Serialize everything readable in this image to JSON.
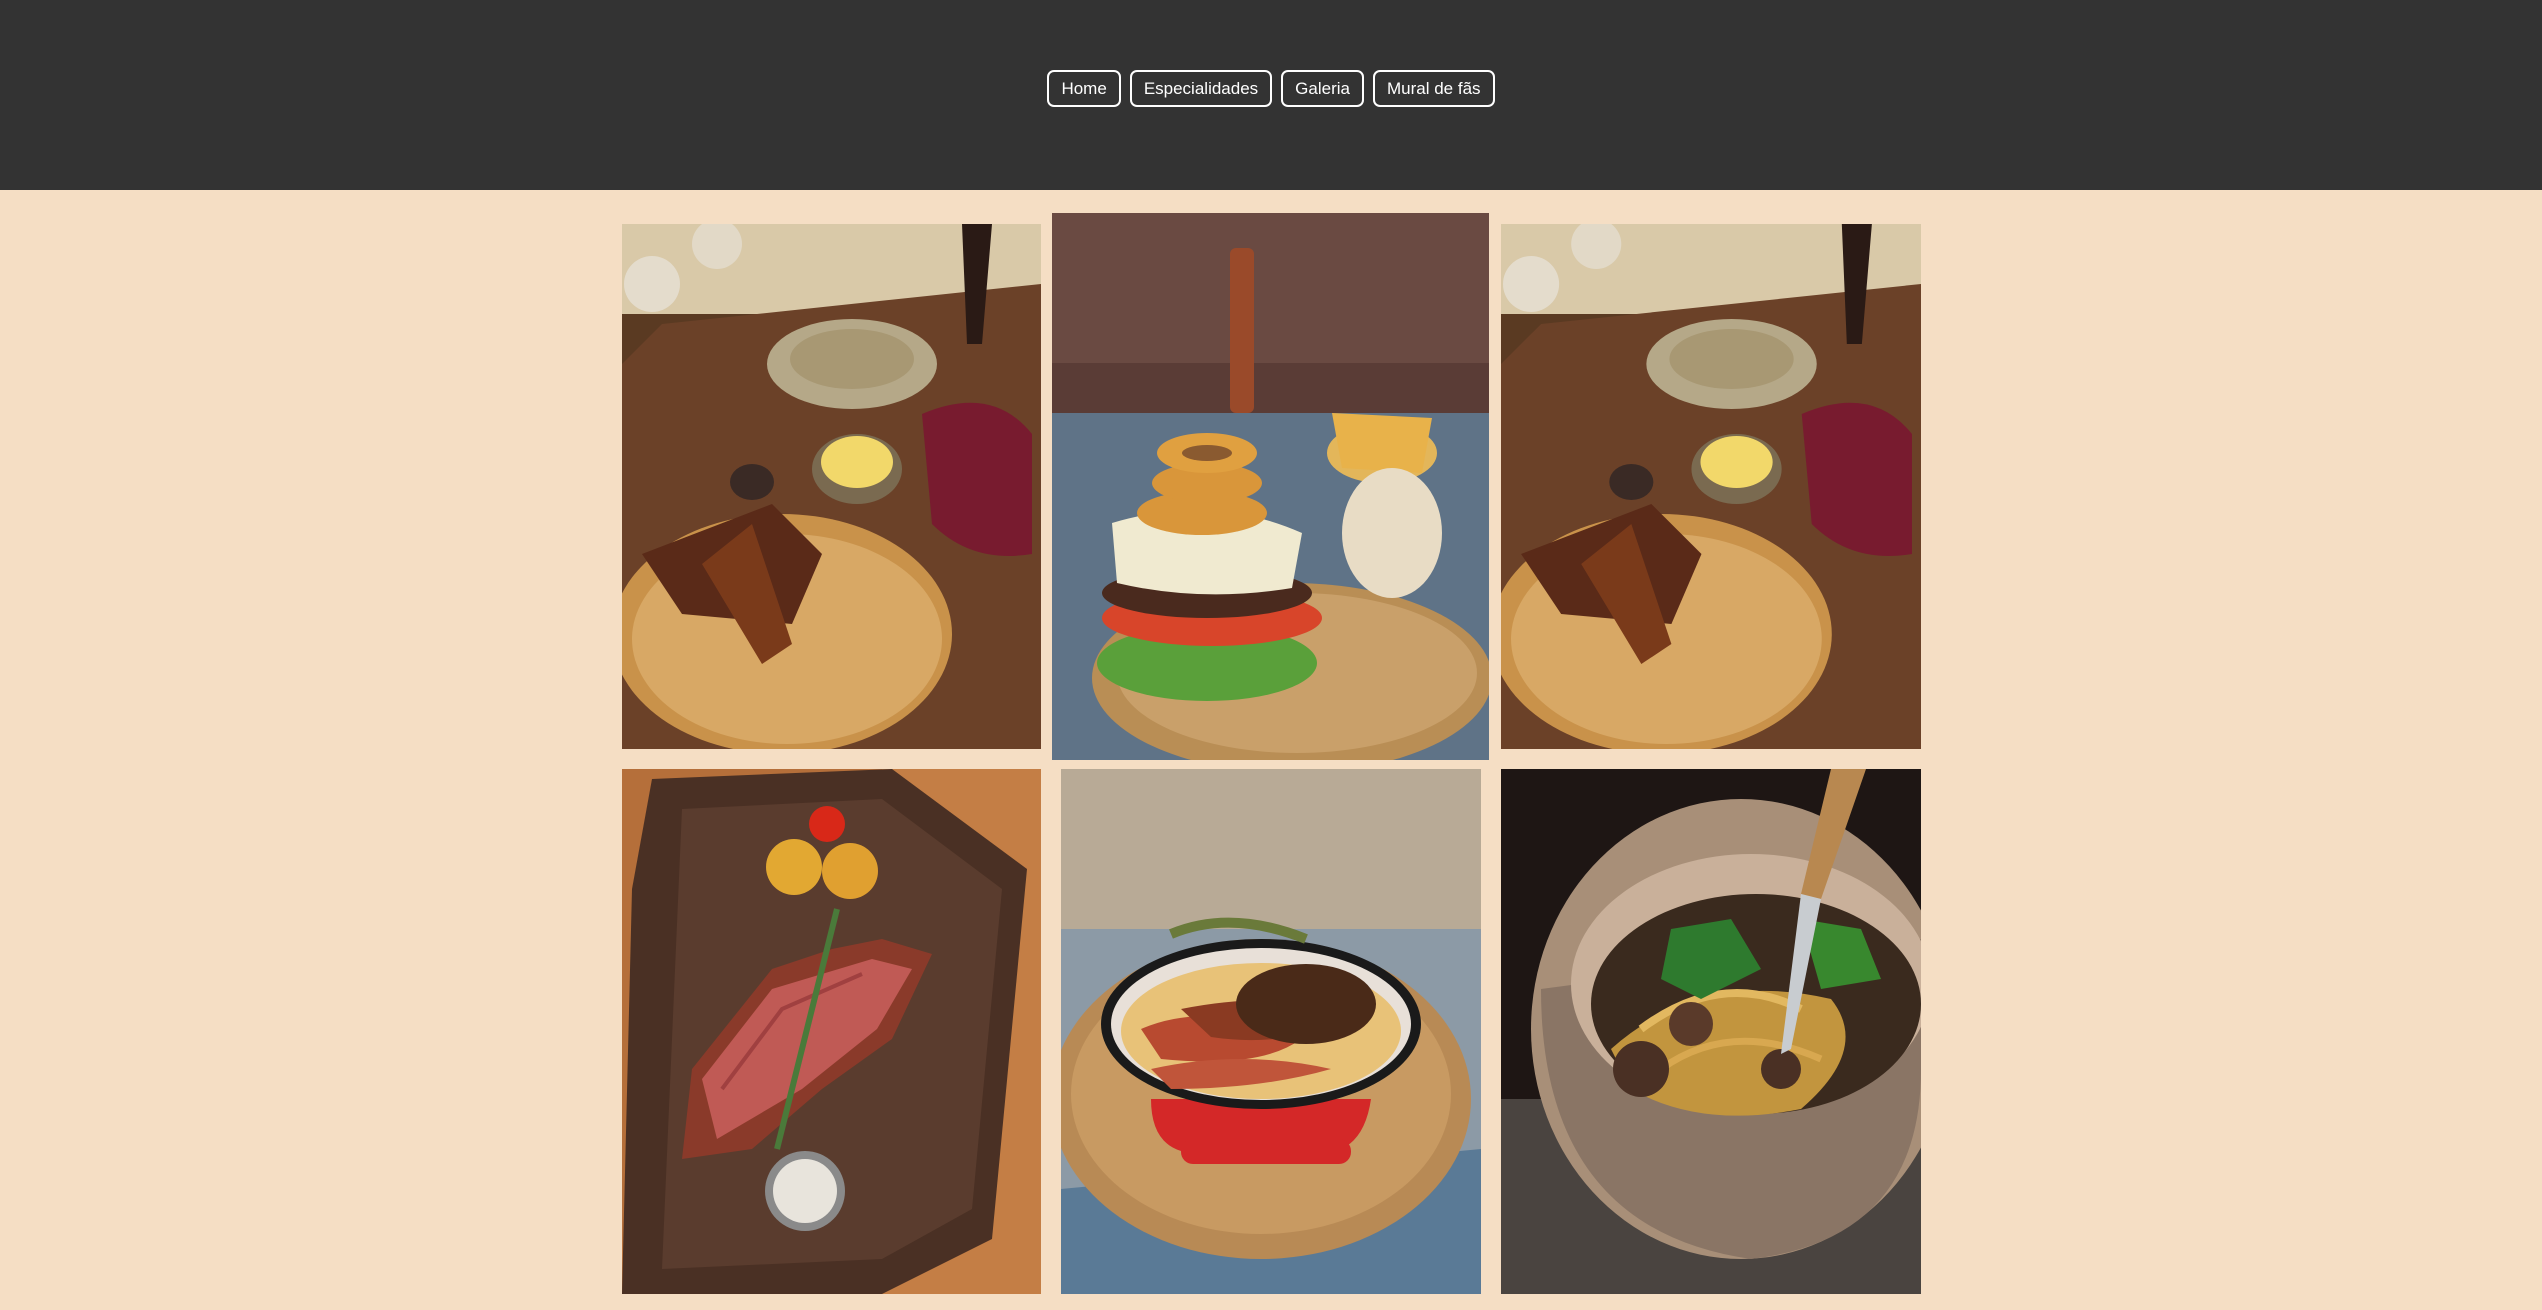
{
  "nav": {
    "items": [
      {
        "label": "Home"
      },
      {
        "label": "Especialidades"
      },
      {
        "label": "Galeria"
      },
      {
        "label": "Mural de fãs"
      }
    ]
  },
  "colors": {
    "header_bg": "#333333",
    "page_bg": "#f5dec4",
    "nav_border": "#ffffff"
  },
  "gallery": {
    "photos": [
      {
        "subject": "ribs-with-wine"
      },
      {
        "subject": "burger-with-onion-rings"
      },
      {
        "subject": "ribs-with-wine"
      },
      {
        "subject": "sliced-steak-on-board"
      },
      {
        "subject": "sausage-skillet"
      },
      {
        "subject": "mushroom-pasta-bowl"
      }
    ]
  }
}
